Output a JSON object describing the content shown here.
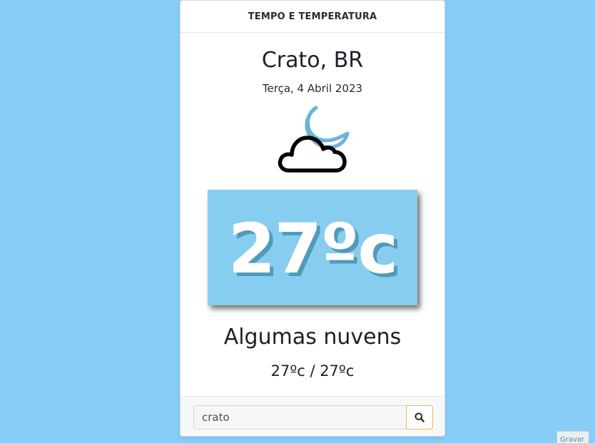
{
  "header": {
    "title": "TEMPO E TEMPERATURA"
  },
  "location": {
    "city": "Crato, BR",
    "date": "Terça, 4 Abril 2023"
  },
  "weather": {
    "icon": "night-partly-cloudy-icon",
    "temperature": "27ºc",
    "description": "Algumas nuvens",
    "min_max": "27ºc / 27ºc"
  },
  "search": {
    "value": "crato",
    "icon": "search-icon"
  },
  "corner_button": {
    "label": "Gravar"
  },
  "colors": {
    "background": "#87cdf7",
    "temp_box": "#87cdf0",
    "temp_shadow": "#4f9bb8",
    "moon": "#6cb3d8",
    "search_button_border": "#e9b84a"
  }
}
